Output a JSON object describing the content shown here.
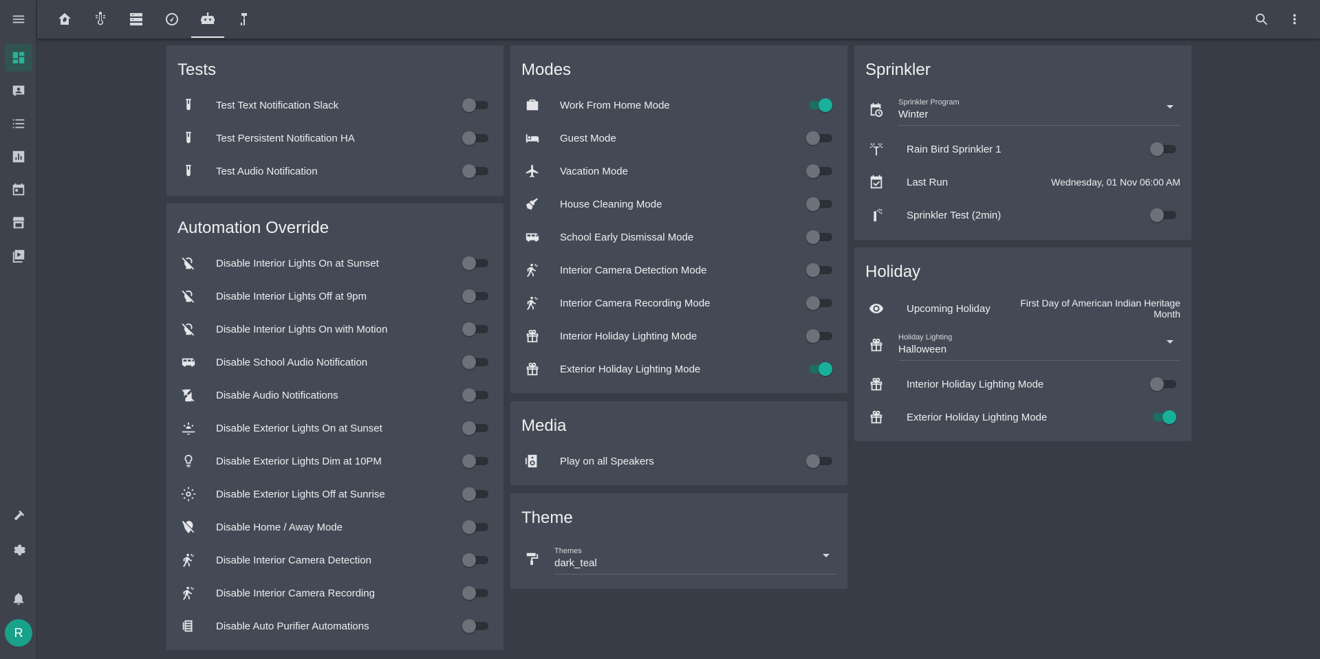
{
  "topbar": {
    "tabs": [
      {
        "icon": "home-leaf-icon",
        "active": false
      },
      {
        "icon": "thermometer-icon",
        "active": false
      },
      {
        "icon": "server-icon",
        "active": false
      },
      {
        "icon": "speedometer-icon",
        "active": false
      },
      {
        "icon": "robot-icon",
        "active": true
      },
      {
        "icon": "hammer-icon",
        "active": false
      }
    ],
    "search_icon": "search-icon",
    "menu_icon": "more-vert-icon"
  },
  "sidebar": {
    "items": [
      {
        "icon": "menu-icon"
      },
      {
        "icon": "dashboard-icon",
        "active": true
      },
      {
        "icon": "account-box-icon"
      },
      {
        "icon": "format-list-icon"
      },
      {
        "icon": "chart-box-icon"
      },
      {
        "icon": "calendar-icon"
      },
      {
        "icon": "hacs-store-icon"
      },
      {
        "icon": "media-icon"
      },
      {
        "icon": "hammer-icon"
      },
      {
        "icon": "cog-icon"
      },
      {
        "icon": "bell-icon"
      }
    ],
    "avatar_letter": "R"
  },
  "tests": {
    "title": "Tests",
    "rows": [
      {
        "label": "Test Text Notification Slack",
        "on": false
      },
      {
        "label": "Test Persistent Notification HA",
        "on": false
      },
      {
        "label": "Test Audio Notification",
        "on": false
      }
    ]
  },
  "automation": {
    "title": "Automation Override",
    "rows": [
      {
        "label": "Disable Interior Lights On at Sunset",
        "on": false
      },
      {
        "label": "Disable Interior Lights Off at 9pm",
        "on": false
      },
      {
        "label": "Disable Interior Lights On with Motion",
        "on": false
      },
      {
        "label": "Disable School Audio Notification",
        "on": false
      },
      {
        "label": "Disable Audio Notifications",
        "on": false
      },
      {
        "label": "Disable Exterior Lights On at Sunset",
        "on": false
      },
      {
        "label": "Disable Exterior Lights Dim at 10PM",
        "on": false
      },
      {
        "label": "Disable Exterior Lights Off at Sunrise",
        "on": false
      },
      {
        "label": "Disable Home / Away Mode",
        "on": false
      },
      {
        "label": "Disable Interior Camera Detection",
        "on": false
      },
      {
        "label": "Disable Interior Camera Recording",
        "on": false
      },
      {
        "label": "Disable Auto Purifier Automations",
        "on": false
      }
    ]
  },
  "modes": {
    "title": "Modes",
    "rows": [
      {
        "label": "Work From Home Mode",
        "on": true
      },
      {
        "label": "Guest Mode",
        "on": false
      },
      {
        "label": "Vacation Mode",
        "on": false
      },
      {
        "label": "House Cleaning Mode",
        "on": false
      },
      {
        "label": "School Early Dismissal Mode",
        "on": false
      },
      {
        "label": "Interior Camera Detection Mode",
        "on": false
      },
      {
        "label": "Interior Camera Recording Mode",
        "on": false
      },
      {
        "label": "Interior Holiday Lighting Mode",
        "on": false
      },
      {
        "label": "Exterior Holiday Lighting Mode",
        "on": true
      }
    ]
  },
  "media": {
    "title": "Media",
    "rows": [
      {
        "label": "Play on all Speakers",
        "on": false
      }
    ]
  },
  "theme": {
    "title": "Theme",
    "select_label": "Themes",
    "select_value": "dark_teal"
  },
  "sprinkler": {
    "title": "Sprinkler",
    "select_label": "Sprinkler Program",
    "select_value": "Winter",
    "rain_bird": {
      "label": "Rain Bird Sprinkler 1",
      "on": false
    },
    "last_run": {
      "label": "Last Run",
      "value": "Wednesday, 01 Nov 06:00 AM"
    },
    "test": {
      "label": "Sprinkler Test (2min)",
      "on": false
    }
  },
  "holiday": {
    "title": "Holiday",
    "upcoming": {
      "label": "Upcoming Holiday",
      "value_line1": "First Day of American Indian Heritage",
      "value_line2": "Month"
    },
    "select_label": "Holiday Lighting",
    "select_value": "Halloween",
    "interior": {
      "label": "Interior Holiday Lighting Mode",
      "on": false
    },
    "exterior": {
      "label": "Exterior Holiday Lighting Mode",
      "on": true
    }
  },
  "colors": {
    "background": "#373c46",
    "card": "#444a55",
    "accent": "#19b09a"
  }
}
